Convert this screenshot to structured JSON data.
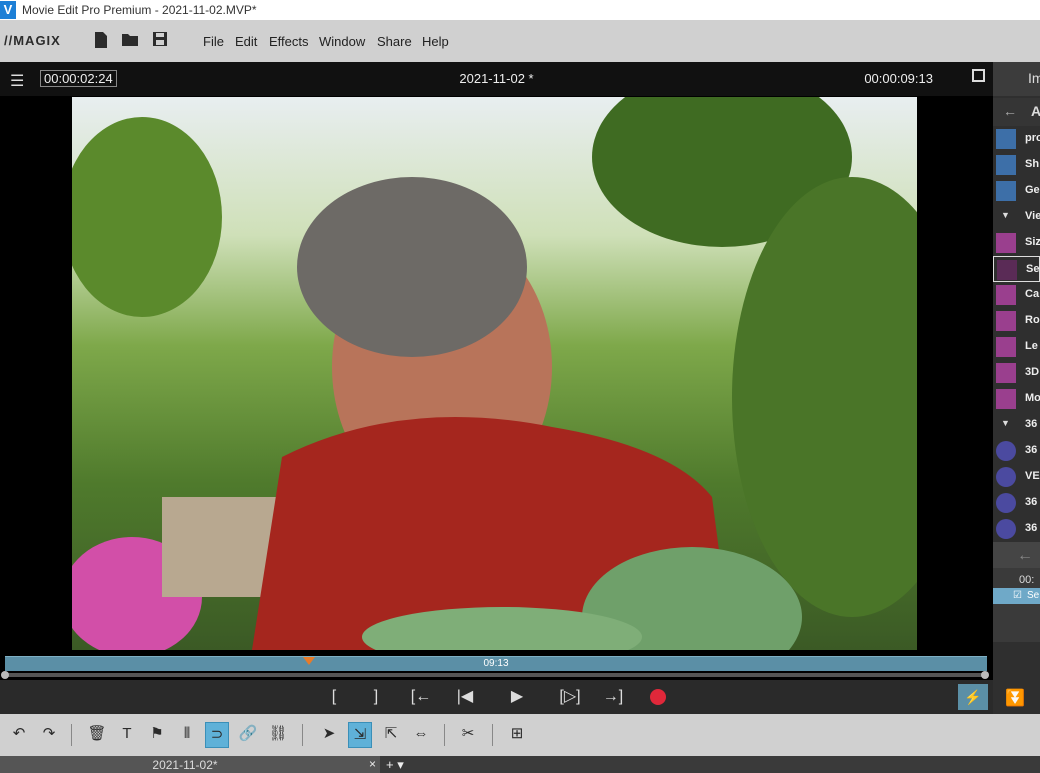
{
  "window": {
    "app_icon": "V",
    "title": "Movie Edit Pro Premium - 2021-11-02.MVP*"
  },
  "menubar": {
    "logo": "//MAGIX",
    "icons": [
      "new-file-icon",
      "open-folder-icon",
      "save-icon"
    ],
    "menus": [
      "File",
      "Edit",
      "Effects",
      "Window",
      "Share",
      "Help"
    ]
  },
  "preview": {
    "timecode_current": "00:00:02:24",
    "project_title": "2021-11-02 *",
    "timecode_total": "00:00:09:13",
    "scrubber_label": "09:13",
    "position_fraction": 0.31
  },
  "transport": {
    "buttons": [
      "[",
      "]",
      "[←",
      "|◀",
      "▶",
      "[▷]",
      "→]"
    ],
    "record_color": "#e0283a"
  },
  "right_panel": {
    "header": "Im",
    "nav": "A",
    "items": [
      {
        "label": "pro",
        "icon": "blue"
      },
      {
        "label": "Sh",
        "icon": "blue"
      },
      {
        "label": "Ge",
        "icon": "blue"
      },
      {
        "label": "Vie",
        "group": true
      },
      {
        "label": "Siz",
        "icon": "purple"
      },
      {
        "label": "Sec",
        "icon": "purple"
      },
      {
        "label": "Ca",
        "icon": "purple"
      },
      {
        "label": "Ro",
        "icon": "purple"
      },
      {
        "label": "Le",
        "icon": "purple"
      },
      {
        "label": "3D",
        "icon": "purple"
      },
      {
        "label": "Mo",
        "icon": "purple"
      },
      {
        "label": "36",
        "group": true
      },
      {
        "label": "36",
        "icon": "violet"
      },
      {
        "label": "VE",
        "icon": "violet"
      },
      {
        "label": "36",
        "icon": "violet"
      },
      {
        "label": "36",
        "icon": "violet"
      }
    ],
    "lower_timecode": "00:",
    "lower_selected": "Se"
  },
  "tabs": {
    "project_tab": "2021-11-02*",
    "close": "×",
    "add": "+ ▾"
  },
  "colors": {
    "accent": "#5fb1d8",
    "scrubber": "#5b8fa6",
    "marker": "#e87b2a"
  }
}
